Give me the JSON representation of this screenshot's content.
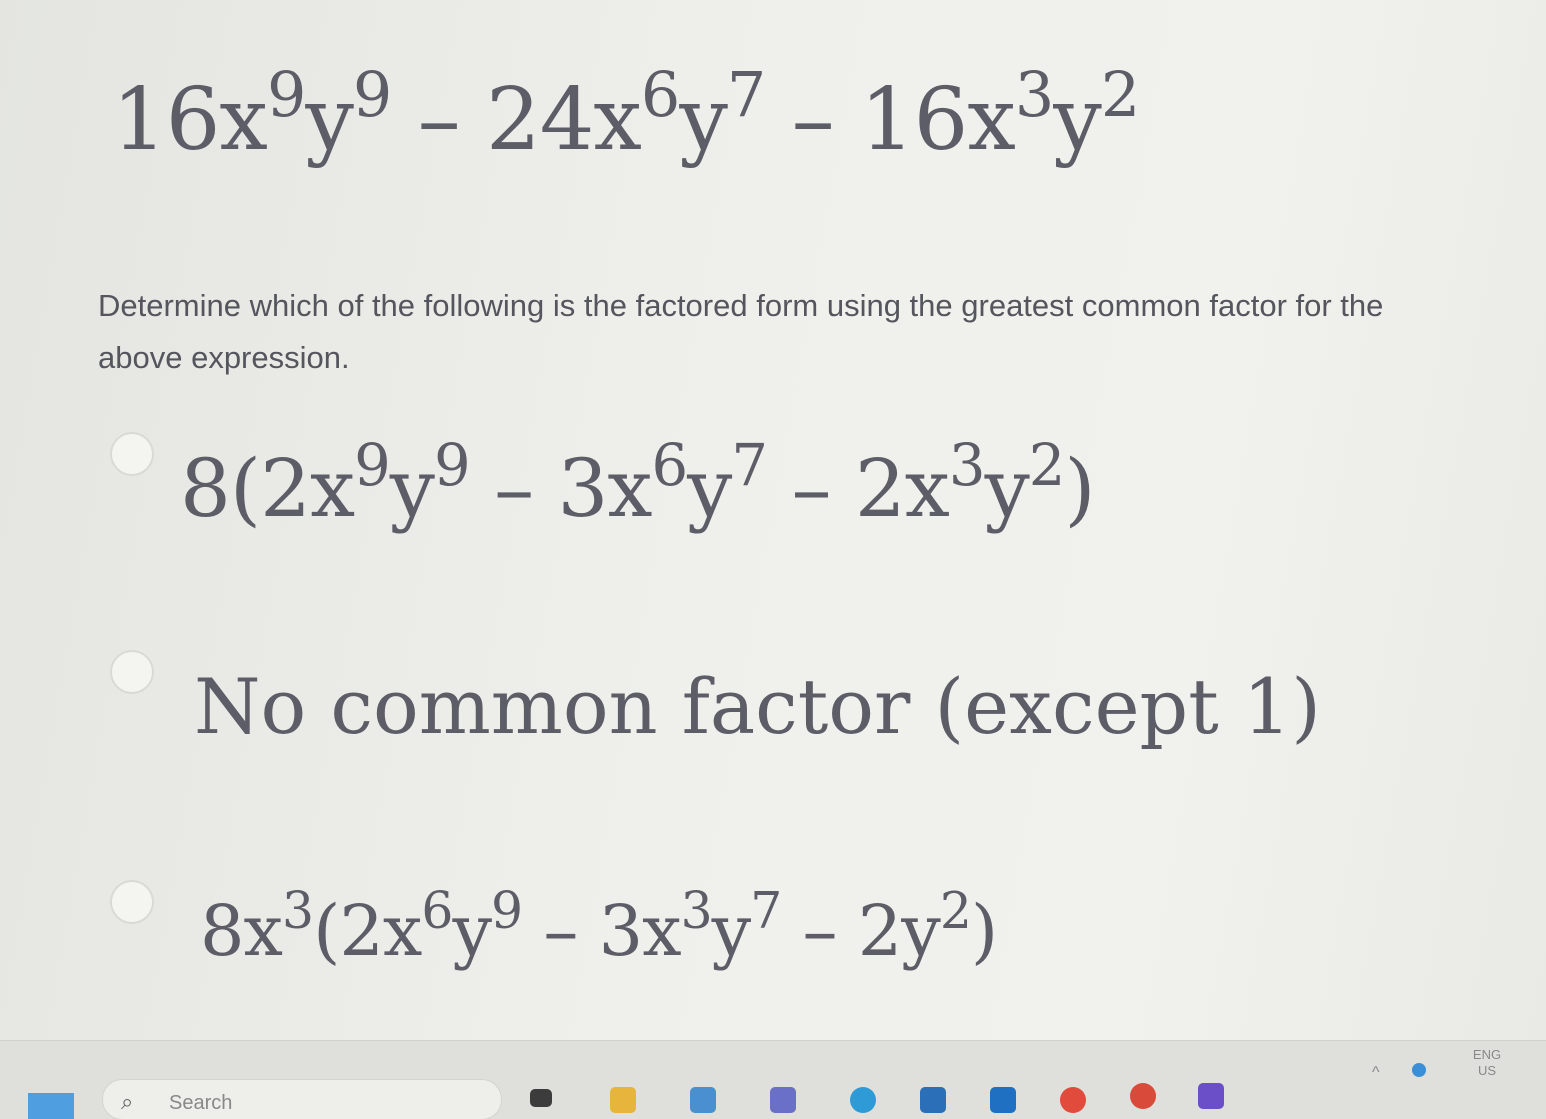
{
  "question": {
    "expression": [
      {
        "t": "16x"
      },
      {
        "sup": "9"
      },
      {
        "t": "y"
      },
      {
        "sup": "9"
      },
      {
        "t": " – 24x"
      },
      {
        "sup": "6"
      },
      {
        "t": "y"
      },
      {
        "sup": "7"
      },
      {
        "t": " – 16x"
      },
      {
        "sup": "3"
      },
      {
        "t": "y"
      },
      {
        "sup": "2"
      }
    ],
    "prompt": "Determine which of the following is the factored form using the greatest common factor for the above expression."
  },
  "options": [
    {
      "id": "a",
      "selected": false,
      "parts": [
        {
          "t": "8(2x"
        },
        {
          "sup": "9"
        },
        {
          "t": "y"
        },
        {
          "sup": "9"
        },
        {
          "t": " – 3x"
        },
        {
          "sup": "6"
        },
        {
          "t": "y"
        },
        {
          "sup": "7"
        },
        {
          "t": " – 2x"
        },
        {
          "sup": "3"
        },
        {
          "t": "y"
        },
        {
          "sup": "2"
        },
        {
          "t": ")"
        }
      ]
    },
    {
      "id": "b",
      "selected": false,
      "parts": [
        {
          "t": "No common factor (except 1)"
        }
      ]
    },
    {
      "id": "c",
      "selected": false,
      "parts": [
        {
          "t": "8x"
        },
        {
          "sup": "3"
        },
        {
          "t": "(2x"
        },
        {
          "sup": "6"
        },
        {
          "t": "y"
        },
        {
          "sup": "9"
        },
        {
          "t": " – 3x"
        },
        {
          "sup": "3"
        },
        {
          "t": "y"
        },
        {
          "sup": "7"
        },
        {
          "t": " – 2y"
        },
        {
          "sup": "2"
        },
        {
          "t": ")"
        }
      ]
    }
  ],
  "taskbar": {
    "search_placeholder": "Search",
    "language": "ENG",
    "locale": "US",
    "icons": [
      "start-icon",
      "file-explorer-icon",
      "folder-icon",
      "photos-icon",
      "teams-icon",
      "edge-icon",
      "store-icon",
      "outlook-icon",
      "chrome-icon",
      "chrome-alt-icon",
      "app-icon"
    ]
  },
  "colors": {
    "math_text": "#5d5d68",
    "prompt_text": "#55555e",
    "background": "#efefeb",
    "start_blue": "#4f9fe0"
  }
}
